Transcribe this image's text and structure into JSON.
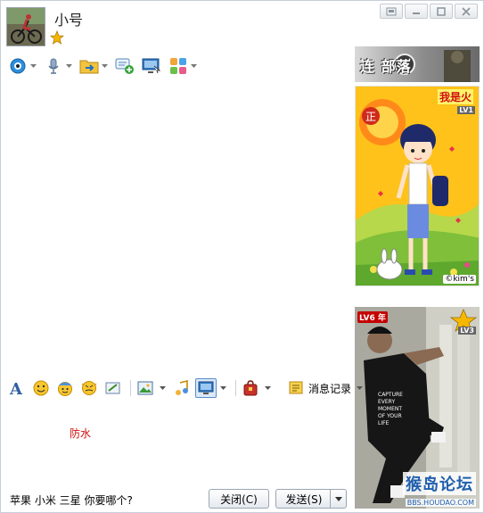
{
  "window": {
    "contact_name": "小号",
    "controls": [
      "skin-icon",
      "minimize-icon",
      "maximize-icon",
      "close-icon"
    ]
  },
  "top_toolbar": {
    "items": [
      {
        "icon": "video-camera-icon",
        "has_dropdown": true
      },
      {
        "icon": "microphone-icon",
        "has_dropdown": true
      },
      {
        "icon": "file-transfer-icon",
        "has_dropdown": true
      },
      {
        "icon": "add-group-chat-icon",
        "has_dropdown": false
      },
      {
        "icon": "remote-desktop-icon",
        "has_dropdown": false
      },
      {
        "icon": "apps-icon",
        "has_dropdown": true
      }
    ]
  },
  "ad_banner": {
    "text": "连 部落"
  },
  "show_panel": {
    "label": "我是火",
    "level": "LV1",
    "watermark": "©kim's"
  },
  "photo_panel": {
    "level_badge": "LV6",
    "year_badge": "年",
    "level": "LV3",
    "watermark": "猴岛论坛",
    "watermark_url": "BBS.HOUDAO.COM"
  },
  "format_toolbar": {
    "history_label": "消息记录"
  },
  "input": {
    "text": "防水"
  },
  "status": {
    "text": "苹果 小米 三星 你要哪个?"
  },
  "buttons": {
    "close": "关闭(C)",
    "send": "发送(S)"
  },
  "colors": {
    "accent_red": "#d01010",
    "border": "#c6ced8",
    "watermark_blue": "#1f5fae"
  }
}
